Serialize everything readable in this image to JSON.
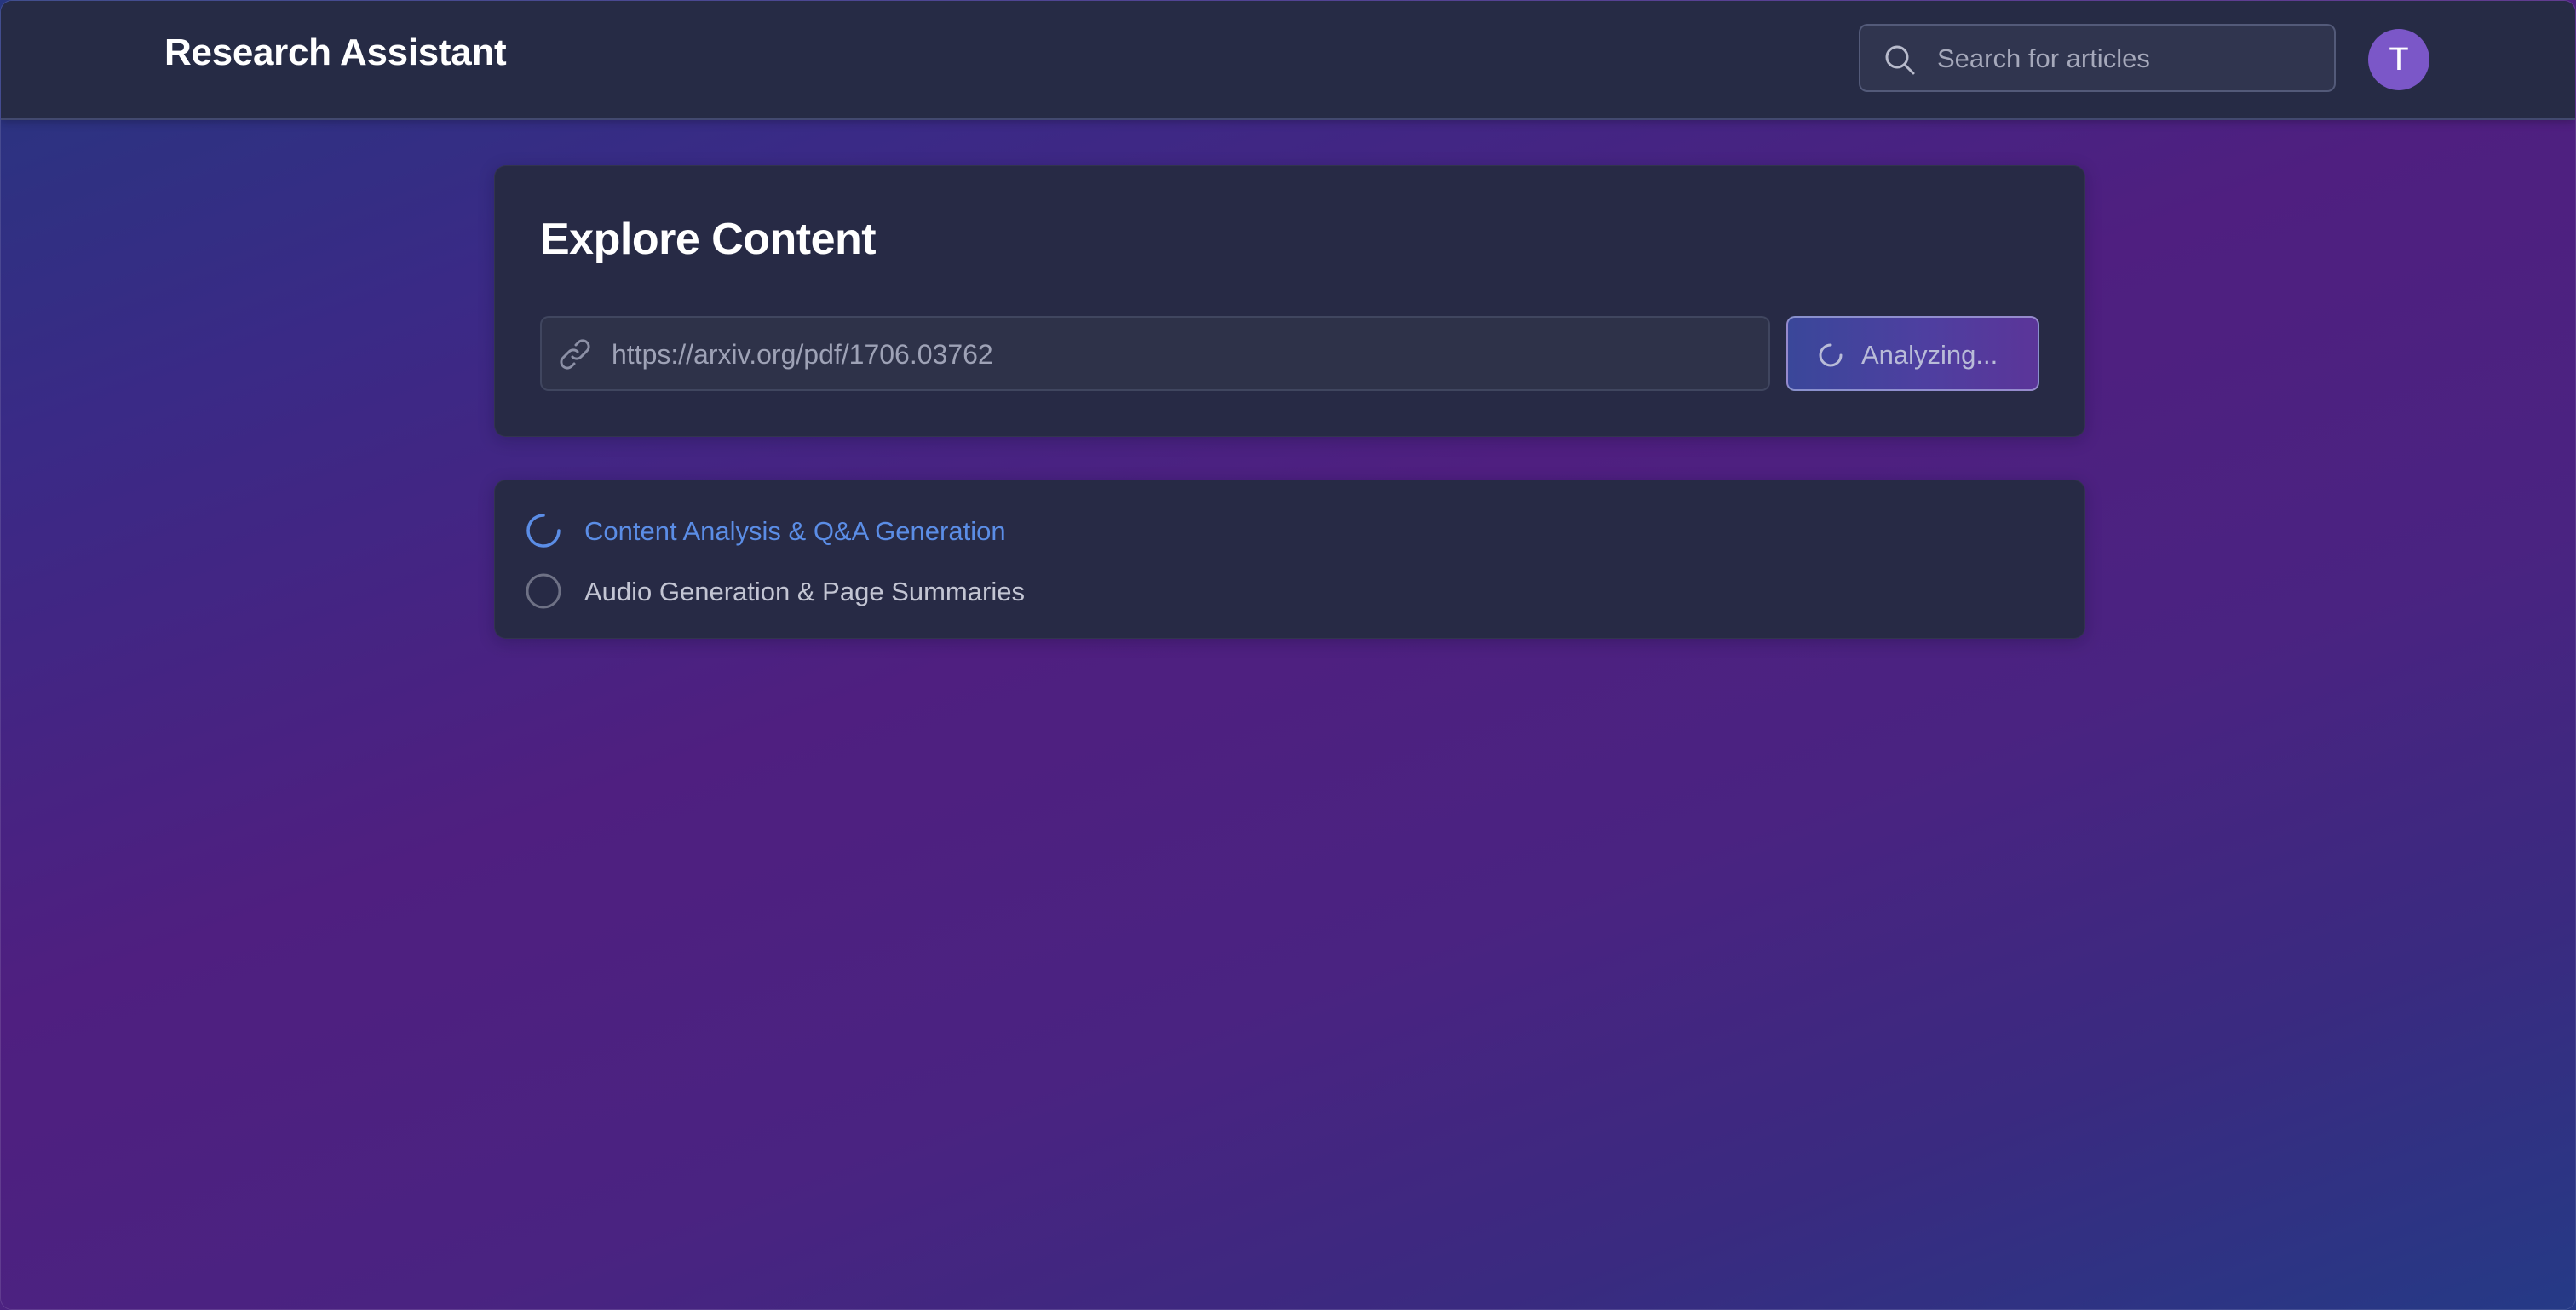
{
  "header": {
    "title": "Research Assistant",
    "search": {
      "placeholder": "Search for articles",
      "value": "",
      "icon": "search-icon"
    },
    "avatar": {
      "initial": "T",
      "color": "#7b57c8"
    }
  },
  "explore": {
    "title": "Explore Content",
    "url_field": {
      "icon": "link-icon",
      "value": "https://arxiv.org/pdf/1706.03762"
    },
    "analyze_button": {
      "label": "Analyzing...",
      "icon": "spinner-icon",
      "state": "loading"
    }
  },
  "steps": [
    {
      "label": "Content Analysis & Q&A Generation",
      "status": "in-progress",
      "icon": "spinner-icon",
      "color": "#5b8de6"
    },
    {
      "label": "Audio Generation & Page Summaries",
      "status": "pending",
      "icon": "empty-circle-icon",
      "color": "#c3c5d3"
    }
  ],
  "colors": {
    "background_gradient": [
      "#27367f",
      "#4f1f80",
      "#253a86"
    ],
    "card": "#272a45",
    "header": "#262b45",
    "accent_blue": "#5b8de6"
  }
}
